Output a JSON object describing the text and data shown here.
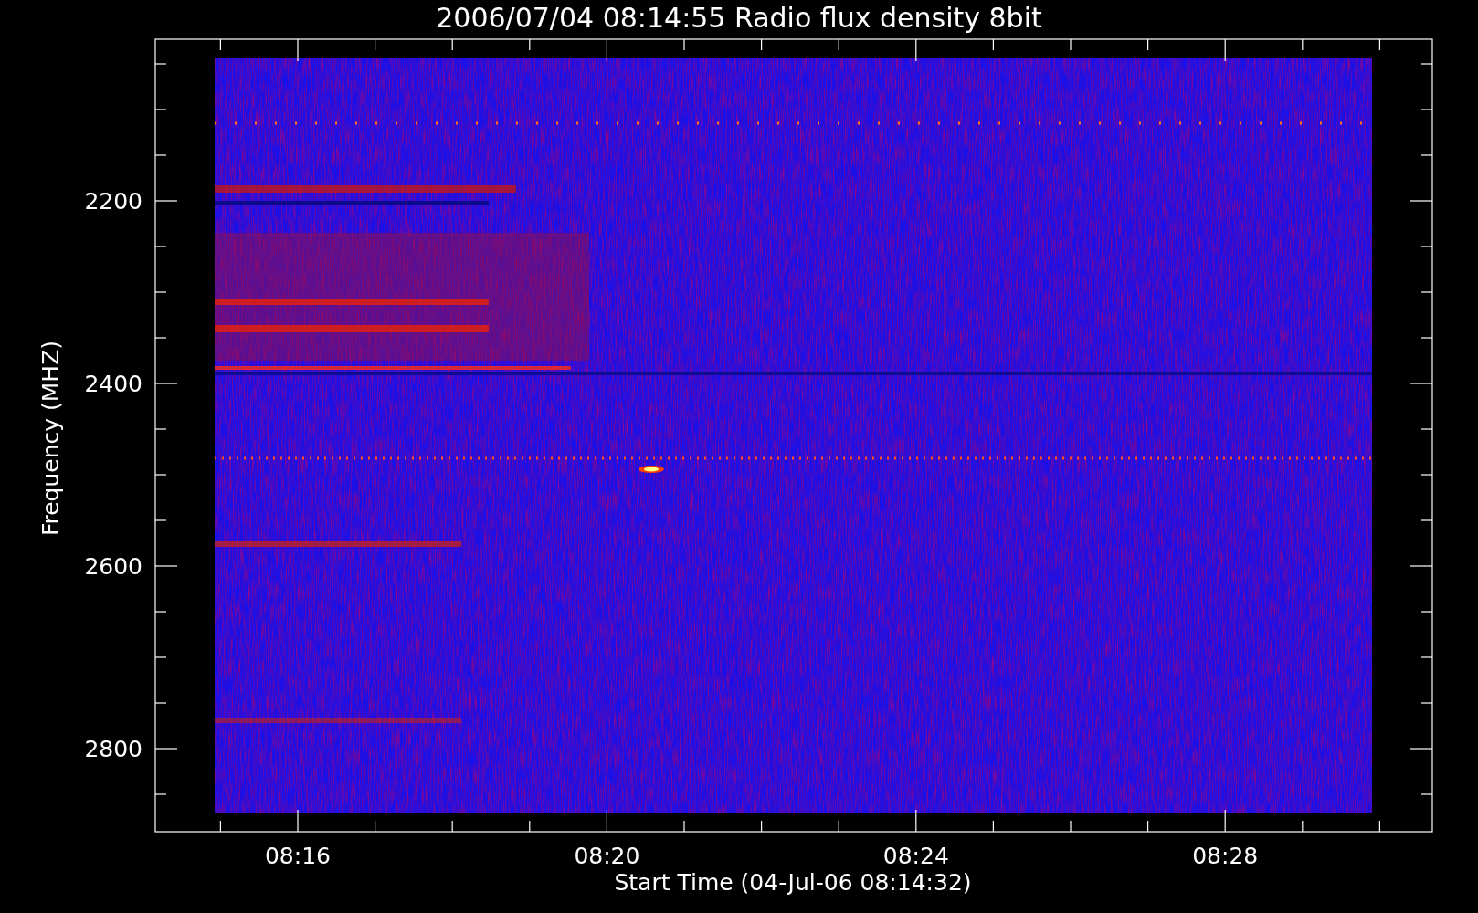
{
  "title": "2006/07/04 08:14:55 Radio flux density 8bit",
  "y_axis": {
    "label": "Frequency (MHZ)",
    "ticks": [
      "2200",
      "2400",
      "2600",
      "2800"
    ]
  },
  "x_axis": {
    "label": "Start Time (04-Jul-06 08:14:32)",
    "ticks": [
      "08:16",
      "08:20",
      "08:24",
      "08:28"
    ]
  }
}
